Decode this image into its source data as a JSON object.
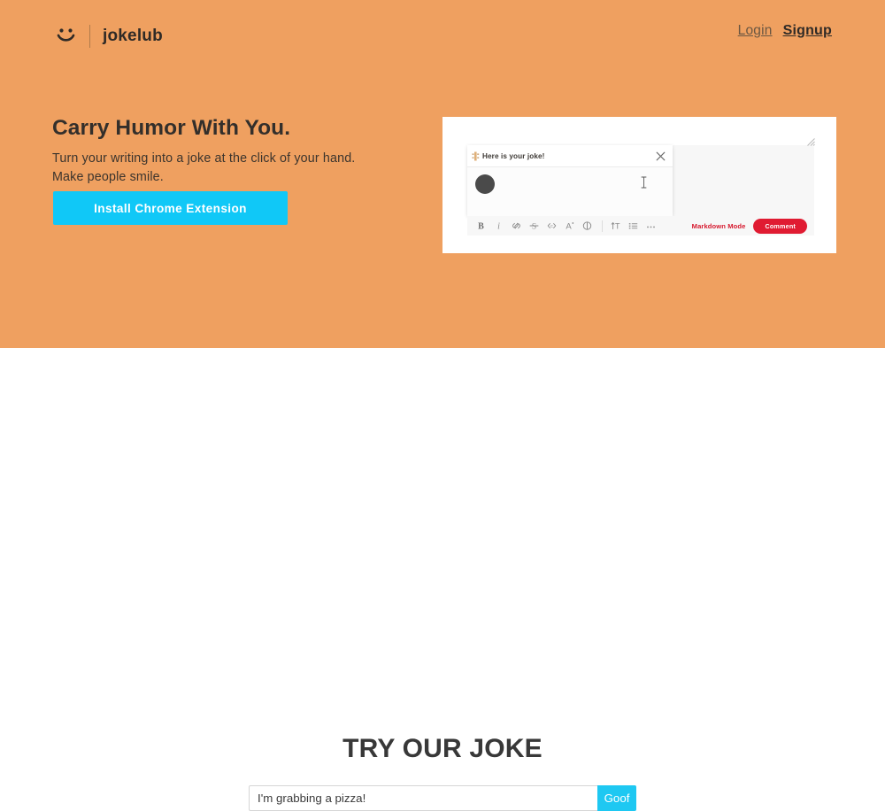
{
  "brand": {
    "name": "jokelub",
    "icon": "smiley-icon"
  },
  "nav": {
    "login": "Login",
    "signup": "Signup"
  },
  "hero": {
    "title": "Carry Humor With You.",
    "subtitle_line1": "Turn your writing into a joke at the click of your hand.",
    "subtitle_line2": "Make people smile.",
    "cta_label": "Install Chrome Extension",
    "background_color": "#efa060",
    "accent_color": "#10c8f7"
  },
  "screenshot": {
    "popup": {
      "title": "Here is your joke!",
      "close_icon": "close-icon",
      "badge_icon": "emoji-badge-icon",
      "caret_icon": "text-cursor-icon",
      "avatar": "user-avatar"
    },
    "toolbar": {
      "icons": [
        "bold-icon",
        "italic-icon",
        "link-icon",
        "strikethrough-icon",
        "code-icon",
        "font-size-icon",
        "info-icon",
        "heading-icon",
        "bulleted-list-icon",
        "more-options-icon"
      ],
      "markdown_label": "Markdown Mode",
      "comment_label": "Comment",
      "accent_color": "#e01b32"
    },
    "resize_handle_icon": "resize-handle-icon"
  },
  "try": {
    "heading": "TRY OUR JOKE",
    "input_value": "I'm grabbing a pizza!",
    "input_placeholder": "I'm grabbing a pizza!",
    "submit_label": "Goof",
    "submit_color": "#1ec8f2"
  }
}
